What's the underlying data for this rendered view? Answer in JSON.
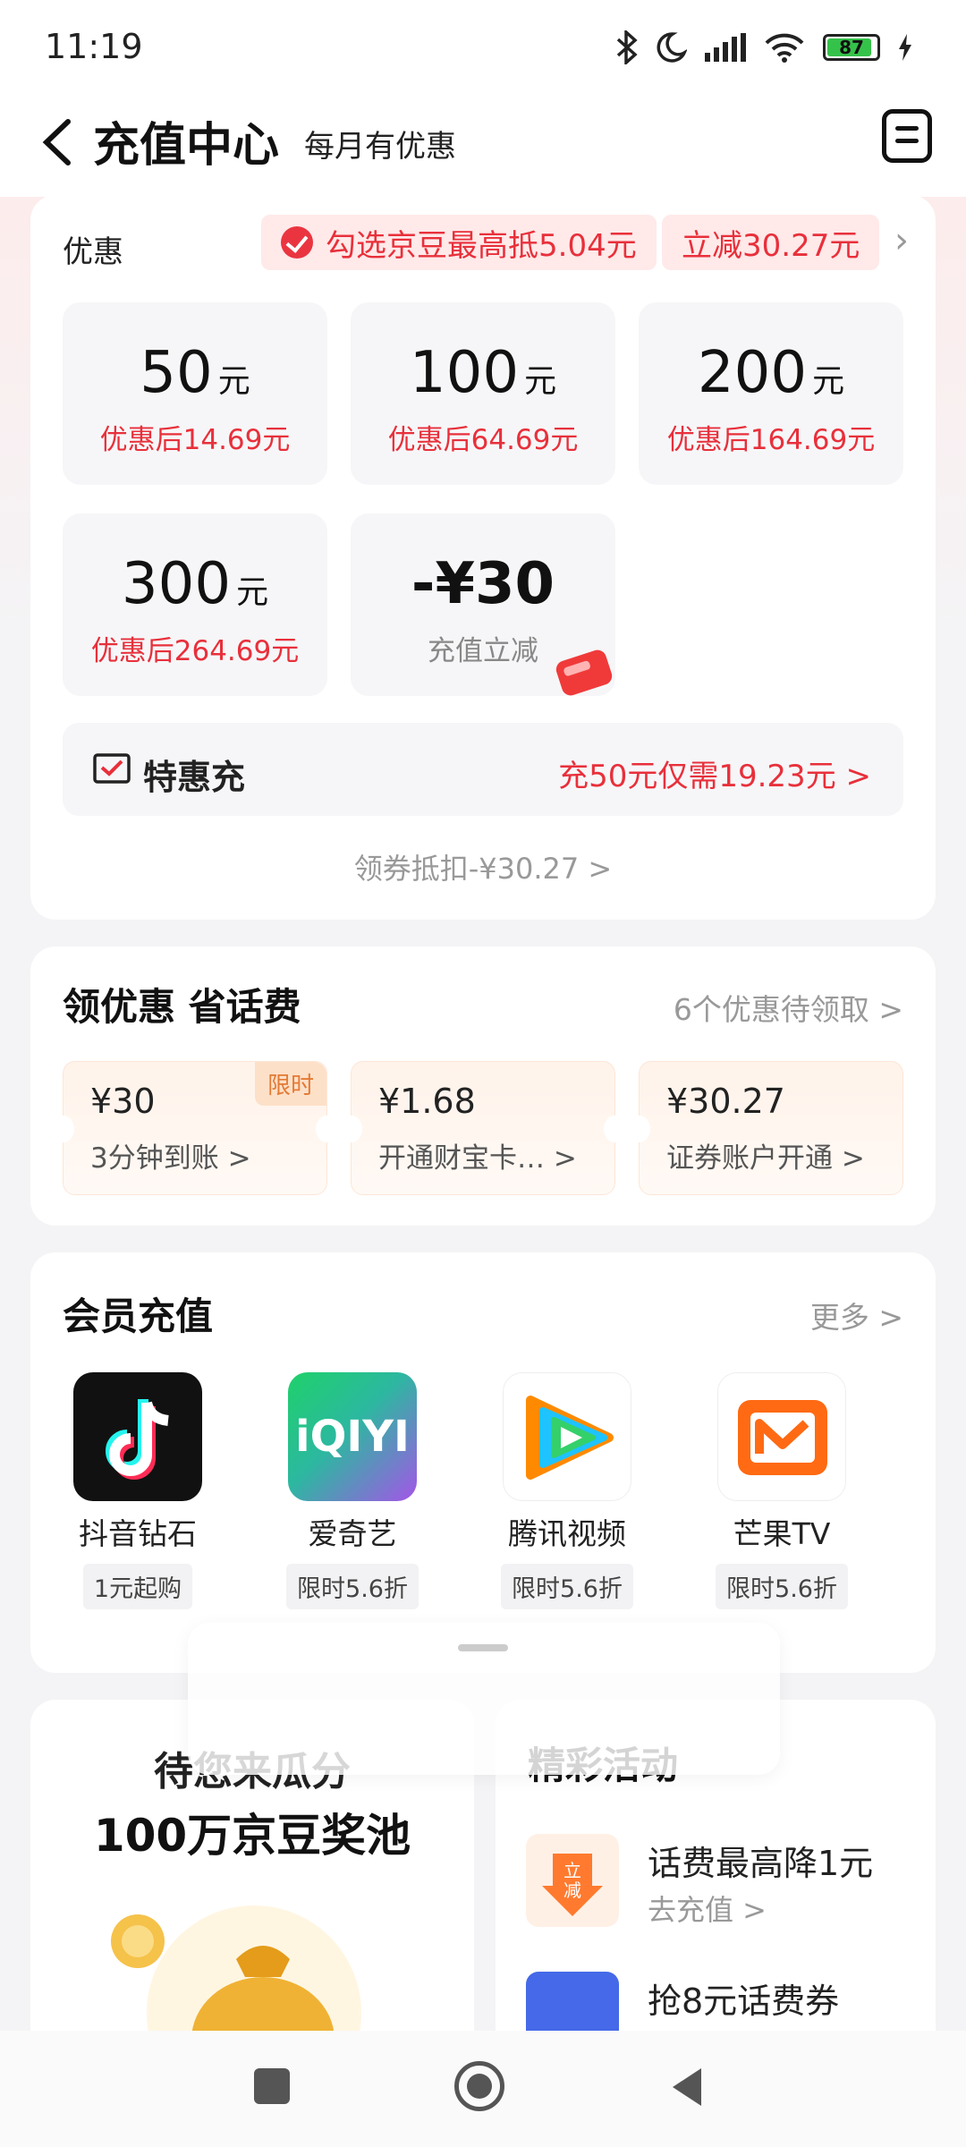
{
  "status": {
    "time": "11:19",
    "battery": "87"
  },
  "header": {
    "title": "充值中心",
    "subtitle": "每月有优惠"
  },
  "recharge": {
    "promo_label": "优惠",
    "promo_tag_1": "勾选京豆最高抵5.04元",
    "promo_tag_2": "立减30.27元",
    "amounts": [
      {
        "value": "50",
        "unit": "元",
        "desc": "优惠后14.69元"
      },
      {
        "value": "100",
        "unit": "元",
        "desc": "优惠后64.69元"
      },
      {
        "value": "200",
        "unit": "元",
        "desc": "优惠后164.69元"
      },
      {
        "value": "300",
        "unit": "元",
        "desc": "优惠后264.69元"
      },
      {
        "value": "-¥30",
        "unit": "",
        "desc": "充值立减"
      }
    ],
    "special_label": "特惠充",
    "special_offer": "充50元仅需19.23元 >",
    "coupon_deduct": "领券抵扣-¥30.27 >"
  },
  "coupons_section": {
    "title": "领优惠 省话费",
    "more": "6个优惠待领取 >",
    "items": [
      {
        "amount": "¥30",
        "desc": "3分钟到账 >",
        "badge": "限时"
      },
      {
        "amount": "¥1.68",
        "desc": "开通财宝卡… >"
      },
      {
        "amount": "¥30.27",
        "desc": "证券账户开通 >"
      }
    ]
  },
  "member_section": {
    "title": "会员充值",
    "more": "更多 >",
    "apps": [
      {
        "name": "抖音钻石",
        "tag": "1元起购",
        "icon": "douyin-icon"
      },
      {
        "name": "爱奇艺",
        "tag": "限时5.6折",
        "icon": "iqiyi-icon"
      },
      {
        "name": "腾讯视频",
        "tag": "限时5.6折",
        "icon": "tencent-video-icon"
      },
      {
        "name": "芒果TV",
        "tag": "限时5.6折",
        "icon": "mango-tv-icon"
      }
    ],
    "iqiyi_logo_text": "iQIYI"
  },
  "bottom": {
    "pool_line1": "待您来瓜分",
    "pool_line2": "100万京豆奖池",
    "activity_title": "精彩活动",
    "activities": [
      {
        "title": "话费最高降1元",
        "sub": "去充值 >",
        "badge": "立减"
      },
      {
        "title": "抢8元话费券",
        "sub": ""
      }
    ]
  },
  "colors": {
    "accent_red": "#e8303b",
    "bg": "#f4f4f6",
    "card": "#ffffff"
  }
}
